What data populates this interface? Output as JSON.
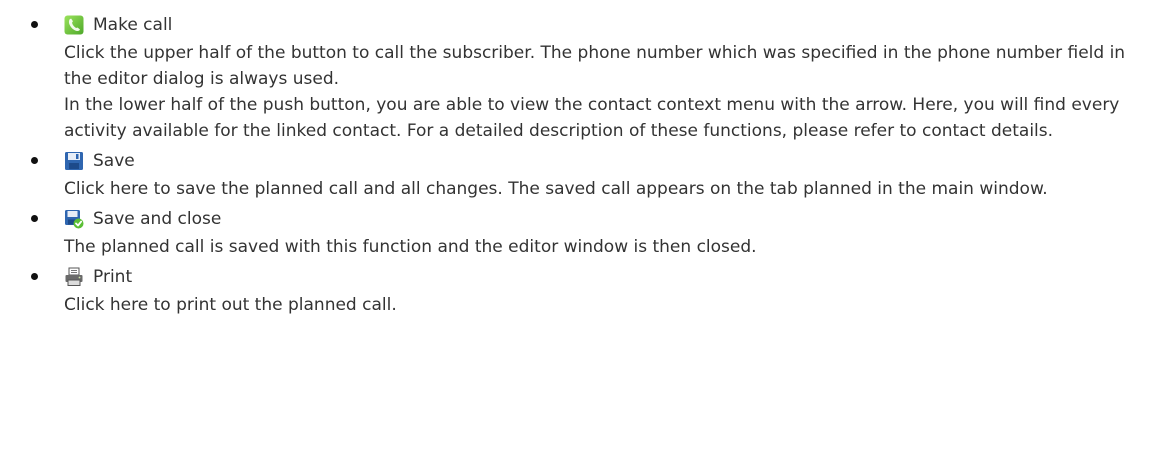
{
  "items": [
    {
      "title": "Make call",
      "icon": "phone-handset-icon",
      "paragraphs": [
        "Click the upper half of the button to call the subscriber. The phone number which was specified in the phone number field in the editor dialog is always used.",
        "In the lower half of the push button, you are able to view the contact context menu with the arrow. Here, you will find every activity available for the linked contact. For a detailed description of these functions, please refer to contact details."
      ]
    },
    {
      "title": "Save",
      "icon": "floppy-disk-icon",
      "paragraphs": [
        "Click here to save the planned call and all changes. The saved call appears on the tab planned in the main window."
      ]
    },
    {
      "title": "Save and close",
      "icon": "save-and-close-icon",
      "paragraphs": [
        "The planned call is saved with this function and the editor window is then closed."
      ]
    },
    {
      "title": "Print",
      "icon": "printer-icon",
      "paragraphs": [
        "Click here to print out the planned call."
      ]
    }
  ],
  "colors": {
    "text": "#333333",
    "phone_icon": "#6cc43a",
    "save_icon": "#2f66b0",
    "check_icon": "#5bbf35"
  }
}
